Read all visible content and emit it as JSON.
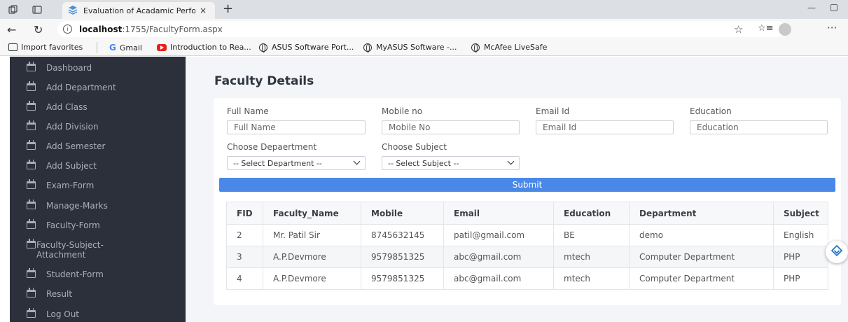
{
  "browser": {
    "tab_title": "Evaluation of Acadamic Performa",
    "tab_close": "×",
    "new_tab": "+",
    "url_host": "localhost",
    "url_path": ":1755/FacultyForm.aspx",
    "bookmarks": [
      {
        "label": "Import favorites",
        "icon": "import-icon"
      },
      {
        "label": "Gmail",
        "icon": "google-icon"
      },
      {
        "label": "Introduction to Rea...",
        "icon": "youtube-icon"
      },
      {
        "label": "ASUS Software Port...",
        "icon": "globe-icon"
      },
      {
        "label": "MyASUS Software -...",
        "icon": "globe-icon"
      },
      {
        "label": "McAfee LiveSafe",
        "icon": "globe-icon"
      }
    ]
  },
  "sidebar": {
    "items": [
      {
        "label": "Dashboard"
      },
      {
        "label": "Add Department"
      },
      {
        "label": "Add Class"
      },
      {
        "label": "Add Division"
      },
      {
        "label": "Add Semester"
      },
      {
        "label": "Add Subject"
      },
      {
        "label": "Exam-Form"
      },
      {
        "label": "Manage-Marks"
      },
      {
        "label": "Faculty-Form"
      },
      {
        "label": "Faculty-Subject-Attachment"
      },
      {
        "label": "Student-Form"
      },
      {
        "label": "Result"
      },
      {
        "label": "Log Out"
      }
    ]
  },
  "page": {
    "title": "Faculty Details"
  },
  "form": {
    "full_name_label": "Full Name",
    "full_name_placeholder": "Full Name",
    "mobile_label": "Mobile no",
    "mobile_placeholder": "Mobile No",
    "email_label": "Email Id",
    "email_placeholder": "Email Id",
    "education_label": "Education",
    "education_placeholder": "Education",
    "department_label": "Choose Depaertment",
    "department_selected": "-- Select Department --",
    "subject_label": "Choose Subject",
    "subject_selected": "-- Select Subject --",
    "submit_label": "Submit"
  },
  "table": {
    "headers": [
      "FID",
      "Faculty_Name",
      "Mobile",
      "Email",
      "Education",
      "Department",
      "Subject"
    ],
    "rows": [
      [
        "2",
        "Mr. Patil Sir",
        "8745632145",
        "patil@gmail.com",
        "BE",
        "demo",
        "English"
      ],
      [
        "3",
        "A.P.Devmore",
        "9579851325",
        "abc@gmail.com",
        "mtech",
        "Computer Department",
        "PHP"
      ],
      [
        "4",
        "A.P.Devmore",
        "9579851325",
        "abc@gmail.com",
        "mtech",
        "Computer Department",
        "PHP"
      ]
    ]
  },
  "colors": {
    "sidebar_bg": "#2b303b",
    "accent": "#4a88e8",
    "main_bg": "#f4f5f8"
  }
}
